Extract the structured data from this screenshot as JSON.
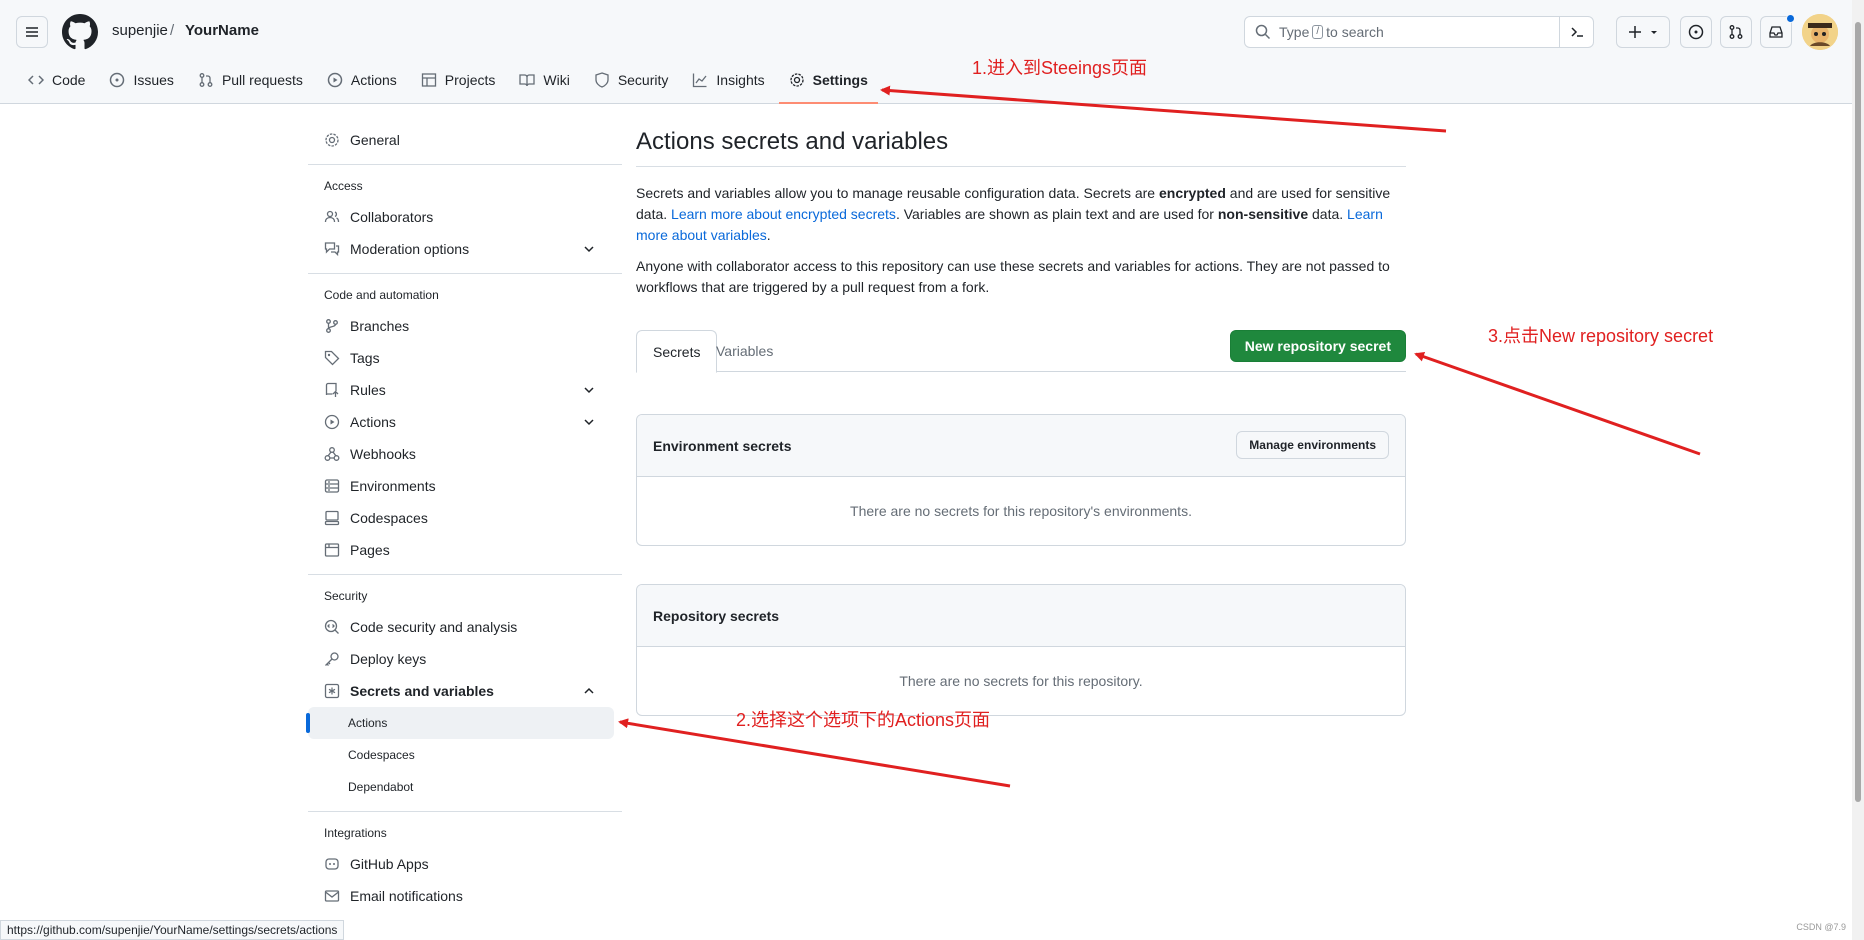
{
  "header": {
    "owner": "supenjie",
    "separator": "/",
    "repo": "YourName",
    "search_prefix": "Type",
    "search_key": "/",
    "search_suffix": "to search"
  },
  "tabs": [
    {
      "label": "Code",
      "icon": "code-icon"
    },
    {
      "label": "Issues",
      "icon": "issue-icon"
    },
    {
      "label": "Pull requests",
      "icon": "pull-request-icon"
    },
    {
      "label": "Actions",
      "icon": "play-icon"
    },
    {
      "label": "Projects",
      "icon": "table-icon"
    },
    {
      "label": "Wiki",
      "icon": "book-icon"
    },
    {
      "label": "Security",
      "icon": "shield-icon"
    },
    {
      "label": "Insights",
      "icon": "graph-icon"
    },
    {
      "label": "Settings",
      "icon": "gear-icon",
      "active": true
    }
  ],
  "sidebar": {
    "general": "General",
    "access_heading": "Access",
    "collaborators": "Collaborators",
    "moderation": "Moderation options",
    "code_heading": "Code and automation",
    "branches": "Branches",
    "tags": "Tags",
    "rules": "Rules",
    "actions": "Actions",
    "webhooks": "Webhooks",
    "environments": "Environments",
    "codespaces": "Codespaces",
    "pages": "Pages",
    "security_heading": "Security",
    "code_security": "Code security and analysis",
    "deploy_keys": "Deploy keys",
    "secrets": "Secrets and variables",
    "sub_actions": "Actions",
    "sub_codespaces": "Codespaces",
    "sub_dependabot": "Dependabot",
    "integrations_heading": "Integrations",
    "github_apps": "GitHub Apps",
    "email_notifications": "Email notifications"
  },
  "main": {
    "title": "Actions secrets and variables",
    "p1_a": "Secrets and variables allow you to manage reusable configuration data. Secrets are ",
    "p1_b": "encrypted",
    "p1_c": " and are used for sensitive data. ",
    "p1_link1": "Learn more about encrypted secrets",
    "p1_d": ". Variables are shown as plain text and are used for ",
    "p1_e": "non-sensitive",
    "p1_f": " data. ",
    "p1_link2": "Learn more about variables",
    "p1_g": ".",
    "p2": "Anyone with collaborator access to this repository can use these secrets and variables for actions. They are not passed to workflows that are triggered by a pull request from a fork.",
    "tab_secrets": "Secrets",
    "tab_variables": "Variables",
    "new_secret_button": "New repository secret",
    "env_title": "Environment secrets",
    "manage_env_button": "Manage environments",
    "env_empty": "There are no secrets for this repository's environments.",
    "repo_title": "Repository secrets",
    "repo_empty": "There are no secrets for this repository."
  },
  "annotations": {
    "step1": "1.进入到Steeings页面",
    "step2": "2.选择这个选项下的Actions页面",
    "step3": "3.点击New repository secret"
  },
  "statusbar": "https://github.com/supenjie/YourName/settings/secrets/actions",
  "watermark": "CSDN @7.9",
  "colors": {
    "primary_button": "#1f883d",
    "link": "#0969da",
    "active_tab_underline": "#fd8c73",
    "annotation": "#e02020"
  }
}
